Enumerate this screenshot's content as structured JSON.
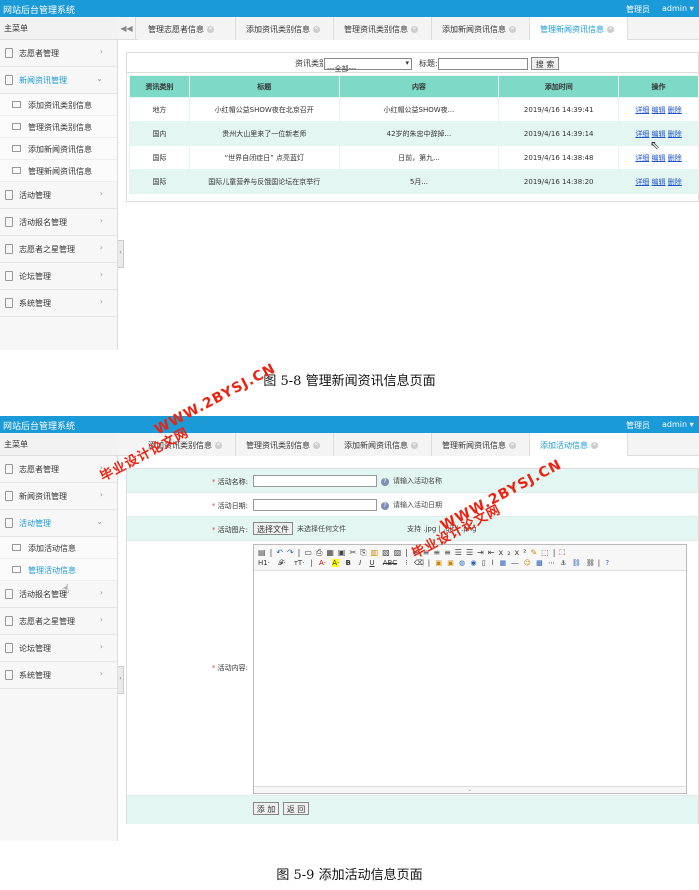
{
  "screen1": {
    "app_title": "网站后台管理系统",
    "role": "管理员",
    "user": "admin ▾",
    "main_menu_label": "主菜单",
    "tab_nav": "◀◀",
    "tabs": [
      "管理志愿者信息",
      "添加资讯类别信息",
      "管理资讯类别信息",
      "添加新闻资讯信息",
      "管理新闻资讯信息"
    ],
    "menu": [
      {
        "label": "志愿者管理",
        "arrow": "›"
      },
      {
        "label": "新闻资讯管理",
        "arrow": "⌄",
        "sub": [
          "添加资讯类别信息",
          "管理资讯类别信息",
          "添加新闻资讯信息",
          "管理新闻资讯信息"
        ]
      },
      {
        "label": "活动管理",
        "arrow": "›"
      },
      {
        "label": "活动报名管理",
        "arrow": "›"
      },
      {
        "label": "志愿者之星管理",
        "arrow": "›"
      },
      {
        "label": "论坛管理",
        "arrow": "›"
      },
      {
        "label": "系统管理",
        "arrow": "›"
      }
    ],
    "search": {
      "category_label": "资讯类别",
      "category_value": "---全部---",
      "title_label": "标题:",
      "title_value": "",
      "button": "搜 索"
    },
    "table": {
      "headers": [
        "资讯类别",
        "标题",
        "内容",
        "添加时间",
        "操作"
      ],
      "rows": [
        [
          "地方",
          "小红帽公益SHOW夜在北京召开",
          "小红帽公益SHOW夜...",
          "2019/4/16 14:39:41"
        ],
        [
          "国内",
          "贵州大山里来了一位新老师",
          "42岁的朱忠中辞掉...",
          "2019/4/16 14:39:14"
        ],
        [
          "国际",
          "“世界自闭症日” 点亮蓝灯",
          "日前，第九...",
          "2019/4/16 14:38:48"
        ],
        [
          "国际",
          "国际儿童营养与反饿国论坛在京举行",
          "5月...",
          "2019/4/16 14:38:20"
        ]
      ],
      "ops": [
        "详细",
        "编辑",
        "删除"
      ]
    }
  },
  "caption1": "图 5-8 管理新闻资讯信息页面",
  "screen2": {
    "app_title": "网站后台管理系统",
    "role": "管理员",
    "user": "admin ▾",
    "main_menu_label": "主菜单",
    "tabs": [
      "添加资讯类别信息",
      "管理资讯类别信息",
      "添加新闻资讯信息",
      "管理新闻资讯信息",
      "添加活动信息"
    ],
    "menu": [
      {
        "label": "志愿者管理",
        "arrow": "›"
      },
      {
        "label": "新闻资讯管理",
        "arrow": "›"
      },
      {
        "label": "活动管理",
        "arrow": "⌄",
        "sub": [
          "添加活动信息",
          "管理活动信息"
        ]
      },
      {
        "label": "活动报名管理",
        "arrow": "›"
      },
      {
        "label": "志愿者之星管理",
        "arrow": "›"
      },
      {
        "label": "论坛管理",
        "arrow": "›"
      },
      {
        "label": "系统管理",
        "arrow": "›"
      }
    ],
    "form": {
      "name_label": "活动名称:",
      "name_hint": "请输入活动名称",
      "date_label": "活动日期:",
      "date_hint": "请输入活动日期",
      "image_label": "活动图片:",
      "file_button": "选择文件",
      "file_status": "未选择任何文件",
      "file_support": "支持 .jpg | .gif | .png",
      "content_label": "活动内容:",
      "submit": "添 加",
      "back": "返 回"
    },
    "editor_row2": [
      "H1·",
      "𝓕·",
      "ᴛT·",
      "A·",
      "A·",
      "B",
      "I",
      "U",
      "ABC"
    ]
  },
  "caption2": "图 5-9 添加活动信息页面",
  "watermarks": [
    "WWW.2BYSJ.CN",
    "毕业设计论文网"
  ],
  "colors": {
    "topbar": "#1a9ad6",
    "table_header": "#7ed9c6",
    "row_alt": "#e4f6f1",
    "watermark": "#e21"
  }
}
